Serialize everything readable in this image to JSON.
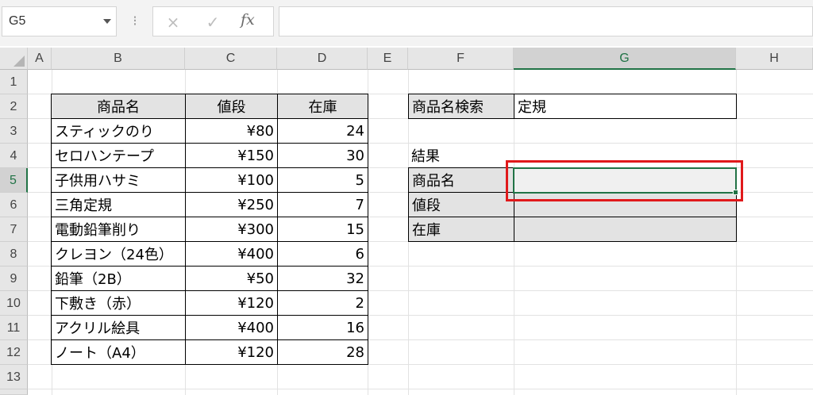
{
  "formula_bar": {
    "name_box": "G5",
    "cancel_icon": "×",
    "enter_icon": "✓",
    "fx_label": "fx",
    "formula": ""
  },
  "columns": [
    "A",
    "B",
    "C",
    "D",
    "E",
    "F",
    "G",
    "H"
  ],
  "rows": [
    "1",
    "2",
    "3",
    "4",
    "5",
    "6",
    "7",
    "8",
    "9",
    "10",
    "11",
    "12",
    "13"
  ],
  "selected": {
    "column": "G",
    "row": "5"
  },
  "product_table": {
    "headers": [
      "商品名",
      "値段",
      "在庫"
    ],
    "rows": [
      [
        "スティックのり",
        "¥80",
        "24"
      ],
      [
        "セロハンテープ",
        "¥150",
        "30"
      ],
      [
        "子供用ハサミ",
        "¥100",
        "5"
      ],
      [
        "三角定規",
        "¥250",
        "7"
      ],
      [
        "電動鉛筆削り",
        "¥300",
        "15"
      ],
      [
        "クレヨン（24色）",
        "¥400",
        "6"
      ],
      [
        "鉛筆（2B）",
        "¥50",
        "32"
      ],
      [
        "下敷き（赤）",
        "¥120",
        "2"
      ],
      [
        "アクリル絵具",
        "¥400",
        "16"
      ],
      [
        "ノート（A4）",
        "¥120",
        "28"
      ]
    ]
  },
  "search": {
    "label": "商品名検索",
    "value": "定規"
  },
  "result": {
    "title": "結果",
    "labels": [
      "商品名",
      "値段",
      "在庫"
    ],
    "values": [
      "",
      "",
      ""
    ]
  },
  "colors": {
    "selection": "#217346",
    "highlight": "#e0191b",
    "header_fill": "#e3e3e3"
  }
}
